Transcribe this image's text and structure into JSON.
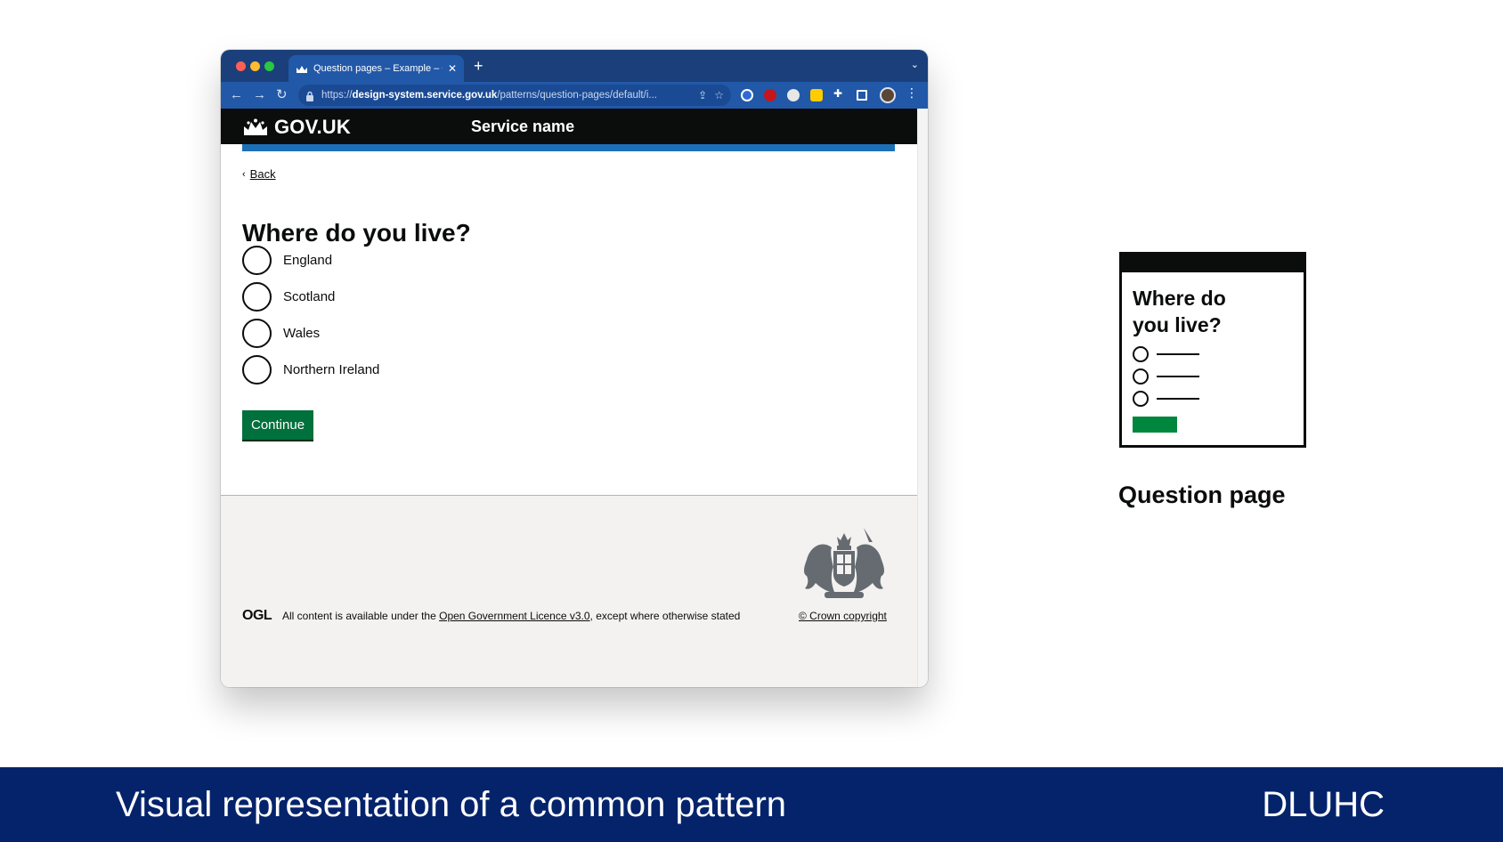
{
  "browser": {
    "tab_title": "Question pages – Example – G",
    "url_scheme": "https://",
    "url_domain": "design-system.service.gov.uk",
    "url_path": "/patterns/question-pages/default/i..."
  },
  "page": {
    "header": {
      "logo_text": "GOV.UK",
      "service_name": "Service name"
    },
    "back_link": "Back",
    "question": "Where do you live?",
    "options": [
      "England",
      "Scotland",
      "Wales",
      "Northern Ireland"
    ],
    "continue_label": "Continue",
    "footer": {
      "ogl_label": "OGL",
      "licence_prefix": "All content is available under the ",
      "licence_link": "Open Government Licence v3.0",
      "licence_suffix": ", except where otherwise stated",
      "copyright": "© Crown copyright"
    }
  },
  "thumbnail": {
    "heading": "Where do you live?",
    "caption": "Question page"
  },
  "banner": {
    "title": "Visual representation of a common pattern",
    "org": "DLUHC"
  },
  "colors": {
    "browser_chrome": "#2258a8",
    "govuk_black": "#0b0c0c",
    "govuk_blue": "#1d70b8",
    "govuk_green": "#00703c",
    "footer_grey": "#f3f2f1",
    "banner_navy": "#04236b"
  }
}
